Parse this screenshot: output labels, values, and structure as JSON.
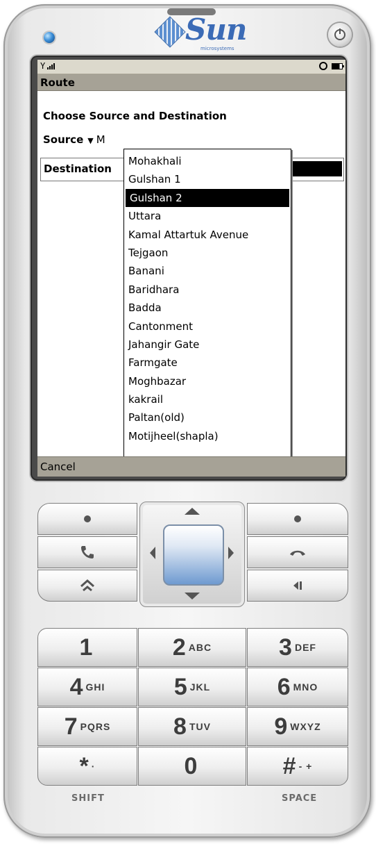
{
  "brand": {
    "name": "Sun",
    "subtitle": "microsystems"
  },
  "title_bar": {
    "title": "Route"
  },
  "form": {
    "heading": "Choose Source and Destination",
    "source_label": "Source",
    "source_value": "M",
    "destination_label": "Destination"
  },
  "popup": {
    "items": [
      "Mohakhali",
      "Gulshan 1",
      "Gulshan 2",
      "Uttara",
      "Kamal Attartuk Avenue",
      "Tejgaon",
      "Banani",
      "Baridhara",
      "Badda",
      "Cantonment",
      "Jahangir Gate",
      "Farmgate",
      "Moghbazar",
      "kakrail",
      "Paltan(old)",
      "Motijheel(shapla)"
    ],
    "selected": "Gulshan 2"
  },
  "soft_keys": {
    "left": "Cancel"
  },
  "keypad": {
    "k1": {
      "digit": "1",
      "letters": ""
    },
    "k2": {
      "digit": "2",
      "letters": "ABC"
    },
    "k3": {
      "digit": "3",
      "letters": "DEF"
    },
    "k4": {
      "digit": "4",
      "letters": "GHI"
    },
    "k5": {
      "digit": "5",
      "letters": "JKL"
    },
    "k6": {
      "digit": "6",
      "letters": "MNO"
    },
    "k7": {
      "digit": "7",
      "letters": "PQRS"
    },
    "k8": {
      "digit": "8",
      "letters": "TUV"
    },
    "k9": {
      "digit": "9",
      "letters": "WXYZ"
    },
    "kstar": {
      "digit": "*",
      "letters": "·"
    },
    "k0": {
      "digit": "0",
      "letters": ""
    },
    "khash": {
      "digit": "#",
      "letters": "- +"
    },
    "shift_label": "SHIFT",
    "space_label": "SPACE"
  }
}
